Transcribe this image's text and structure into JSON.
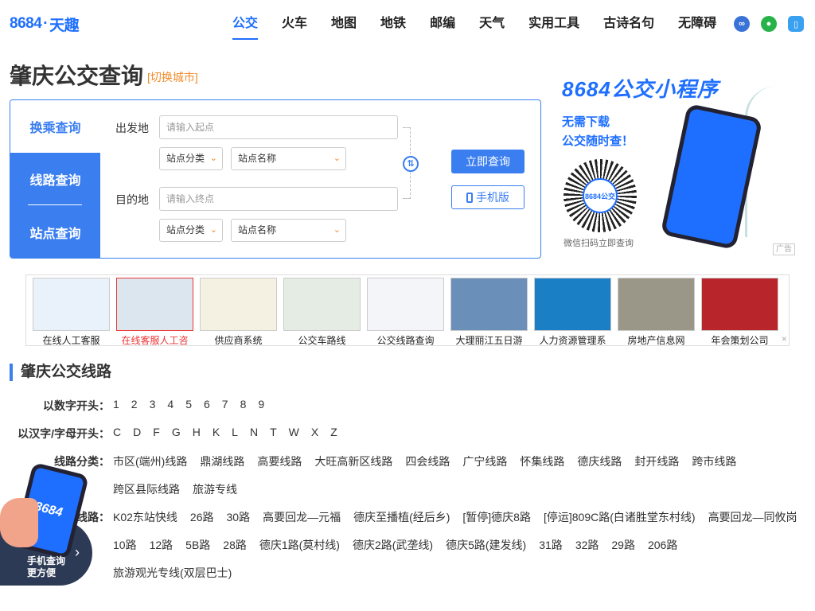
{
  "logo": {
    "brand": "8684",
    "sep": "·",
    "name": "天趣"
  },
  "nav": [
    "公交",
    "火车",
    "地图",
    "地铁",
    "邮编",
    "天气",
    "实用工具",
    "古诗名句",
    "无障碍"
  ],
  "head_icons": [
    "mini-program-icon",
    "wechat-icon",
    "mobile-icon"
  ],
  "title": "肇庆公交查询",
  "switch_city": "[切换城市]",
  "tabs": [
    "换乘查询",
    "线路查询",
    "站点查询"
  ],
  "search": {
    "from_label": "出发地",
    "to_label": "目的地",
    "from_placeholder": "请输入起点",
    "to_placeholder": "请输入终点",
    "category": "站点分类",
    "station": "站点名称",
    "query_btn": "立即查询",
    "mobile_btn": "手机版"
  },
  "promo": {
    "title": "8684公交小程序",
    "sub1": "无需下载",
    "sub2": "公交随时查！",
    "qr_label": "8684公交",
    "caption": "微信扫码立即查询",
    "ad_tag": "广告"
  },
  "ads": [
    {
      "label": "在线人工客服",
      "color": "#e9f1fb"
    },
    {
      "label": "在线客服人工咨",
      "color": "#dbe6ef"
    },
    {
      "label": "供应商系统",
      "color": "#f4f0e2"
    },
    {
      "label": "公交车路线",
      "color": "#e5ece4"
    },
    {
      "label": "公交线路查询",
      "color": "#f3f5f8"
    },
    {
      "label": "大理丽江五日游",
      "color": "#6a8fb8"
    },
    {
      "label": "人力资源管理系",
      "color": "#1b7fc6"
    },
    {
      "label": "房地产信息网",
      "color": "#9a9688"
    },
    {
      "label": "年会策划公司",
      "color": "#b8262c"
    }
  ],
  "section_title": "肇庆公交线路",
  "rows": {
    "num_label": "以数字开头：",
    "nums": [
      "1",
      "2",
      "3",
      "4",
      "5",
      "6",
      "7",
      "8",
      "9"
    ],
    "letter_label": "以汉字/字母开头：",
    "letters": [
      "C",
      "D",
      "F",
      "G",
      "H",
      "K",
      "L",
      "N",
      "T",
      "W",
      "X",
      "Z"
    ],
    "cat_label": "线路分类：",
    "cats1": [
      "市区(端州)线路",
      "鼎湖线路",
      "高要线路",
      "大旺高新区线路",
      "四会线路",
      "广宁线路",
      "怀集线路",
      "德庆线路",
      "封开线路",
      "跨市线路"
    ],
    "cats2": [
      "跨区县际线路",
      "旅游专线"
    ],
    "hot_label": "线路：",
    "hot1": [
      "K02东站快线",
      "26路",
      "30路",
      "高要回龙—元福",
      "德庆至播植(经后乡)",
      "[暂停]德庆8路",
      "[停运]809C路(白诸胜堂东村线)",
      "高要回龙—同攸岗"
    ],
    "hot2": [
      "10路",
      "12路",
      "5B路",
      "28路",
      "德庆1路(莫村线)",
      "德庆2路(武垄线)",
      "德庆5路(建发线)",
      "31路",
      "32路",
      "29路",
      "206路"
    ],
    "hot3": [
      "旅游观光专线(双层巴士)"
    ]
  },
  "float_badge": {
    "phone_text": "8684",
    "line1": "手机查询",
    "line2": "更方便"
  }
}
